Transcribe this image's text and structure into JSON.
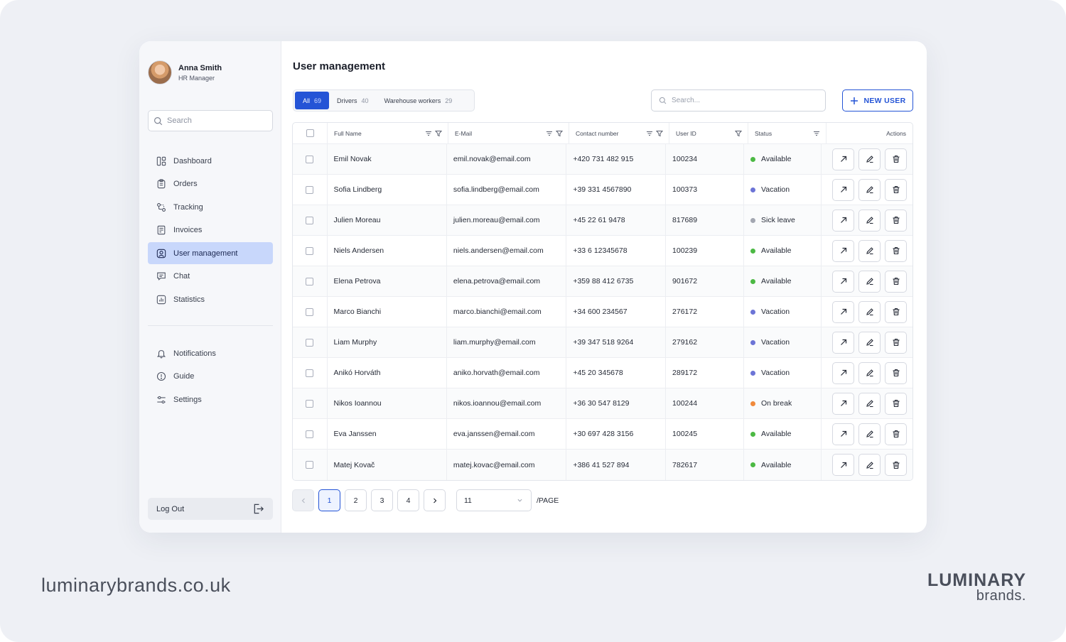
{
  "user": {
    "name": "Anna Smith",
    "role": "HR Manager"
  },
  "sidebar": {
    "search_placeholder": "Search",
    "items": [
      {
        "label": "Dashboard",
        "icon": "dashboard-icon"
      },
      {
        "label": "Orders",
        "icon": "orders-icon"
      },
      {
        "label": "Tracking",
        "icon": "tracking-icon"
      },
      {
        "label": "Invoices",
        "icon": "invoices-icon"
      },
      {
        "label": "User management",
        "icon": "user-management-icon",
        "active": true
      },
      {
        "label": "Chat",
        "icon": "chat-icon"
      },
      {
        "label": "Statistics",
        "icon": "statistics-icon"
      }
    ],
    "secondary_items": [
      {
        "label": "Notifications",
        "icon": "bell-icon"
      },
      {
        "label": "Guide",
        "icon": "info-icon"
      },
      {
        "label": "Settings",
        "icon": "settings-icon"
      }
    ],
    "logout_label": "Log Out"
  },
  "main": {
    "title": "User management",
    "tabs": [
      {
        "label": "All",
        "count": "69",
        "active": true
      },
      {
        "label": "Drivers",
        "count": "40"
      },
      {
        "label": "Warehouse workers",
        "count": "29"
      }
    ],
    "search_placeholder": "Search...",
    "new_user_label": "NEW USER"
  },
  "table": {
    "columns": [
      "Full Name",
      "E-Mail",
      "Contact number",
      "User ID",
      "Status",
      "Actions"
    ],
    "rows": [
      {
        "name": "Emil Novak",
        "email": "emil.novak@email.com",
        "phone": "+420 731 482 915",
        "id": "100234",
        "status": "Available"
      },
      {
        "name": "Sofia Lindberg",
        "email": "sofia.lindberg@email.com",
        "phone": "+39 331 4567890",
        "id": "100373",
        "status": "Vacation"
      },
      {
        "name": "Julien Moreau",
        "email": "julien.moreau@email.com",
        "phone": "+45 22 61 9478",
        "id": "817689",
        "status": "Sick leave"
      },
      {
        "name": "Niels Andersen",
        "email": "niels.andersen@email.com",
        "phone": "+33 6 12345678",
        "id": "100239",
        "status": "Available"
      },
      {
        "name": "Elena Petrova",
        "email": "elena.petrova@email.com",
        "phone": "+359 88 412 6735",
        "id": "901672",
        "status": "Available"
      },
      {
        "name": "Marco Bianchi",
        "email": "marco.bianchi@email.com",
        "phone": "+34 600 234567",
        "id": "276172",
        "status": "Vacation"
      },
      {
        "name": "Liam Murphy",
        "email": "liam.murphy@email.com",
        "phone": "+39 347 518 9264",
        "id": "279162",
        "status": "Vacation"
      },
      {
        "name": "Anikó Horváth",
        "email": "aniko.horvath@email.com",
        "phone": "+45 20 345678",
        "id": "289172",
        "status": "Vacation"
      },
      {
        "name": "Nikos Ioannou",
        "email": "nikos.ioannou@email.com",
        "phone": "+36 30 547 8129",
        "id": "100244",
        "status": "On break"
      },
      {
        "name": "Eva Janssen",
        "email": "eva.janssen@email.com",
        "phone": "+30 697 428 3156",
        "id": "100245",
        "status": "Available"
      },
      {
        "name": "Matej Kovač",
        "email": "matej.kovac@email.com",
        "phone": "+386 41 527 894",
        "id": "782617",
        "status": "Available"
      }
    ],
    "status_colors": {
      "Available": "#4cb944",
      "Vacation": "#6c74d6",
      "Sick leave": "#a3a7b1",
      "On break": "#f08a3c"
    }
  },
  "pagination": {
    "pages": [
      "1",
      "2",
      "3",
      "4"
    ],
    "current_page": "1",
    "per_page_value": "11",
    "per_page_label": "/PAGE"
  },
  "branding": {
    "url": "luminarybrands.co.uk",
    "logo_line1": "LUMINARY",
    "logo_line2": "brands."
  },
  "colors": {
    "accent": "#2454d6",
    "active_nav": "#c8d7fb"
  }
}
